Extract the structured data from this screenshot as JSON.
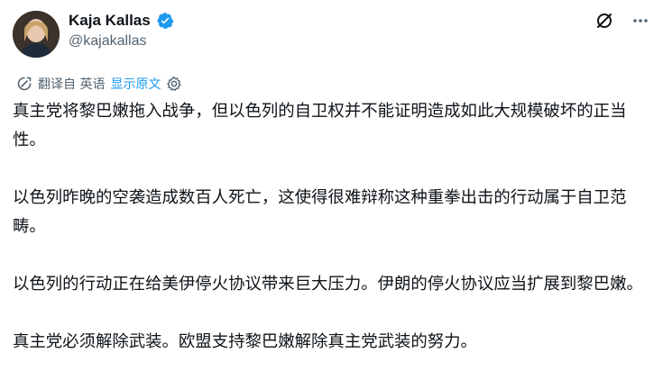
{
  "author": {
    "display_name": "Kaja Kallas",
    "handle": "@kajakallas",
    "verified_badge_color": "#1d9bf0"
  },
  "top_actions": {
    "grok_icon": "grok-icon",
    "more_icon": "more-icon"
  },
  "translation": {
    "icon": "translate-icon",
    "label": "翻译自 英语",
    "show_original": "显示原文",
    "settings_icon": "gear-icon"
  },
  "post": {
    "paragraphs": [
      "真主党将黎巴嫩拖入战争，但以色列的自卫权并不能证明造成如此大规模破坏的正当性。",
      "以色列昨晚的空袭造成数百人死亡，这使得很难辩称这种重拳出击的行动属于自卫范畴。",
      "以色列的行动正在给美伊停火协议带来巨大压力。伊朗的停火协议应当扩展到黎巴嫩。",
      "真主党必须解除武装。欧盟支持黎巴嫩解除真主党武装的努力。"
    ]
  },
  "colors": {
    "text": "#0f1419",
    "secondary": "#536471",
    "link": "#1d9bf0"
  }
}
